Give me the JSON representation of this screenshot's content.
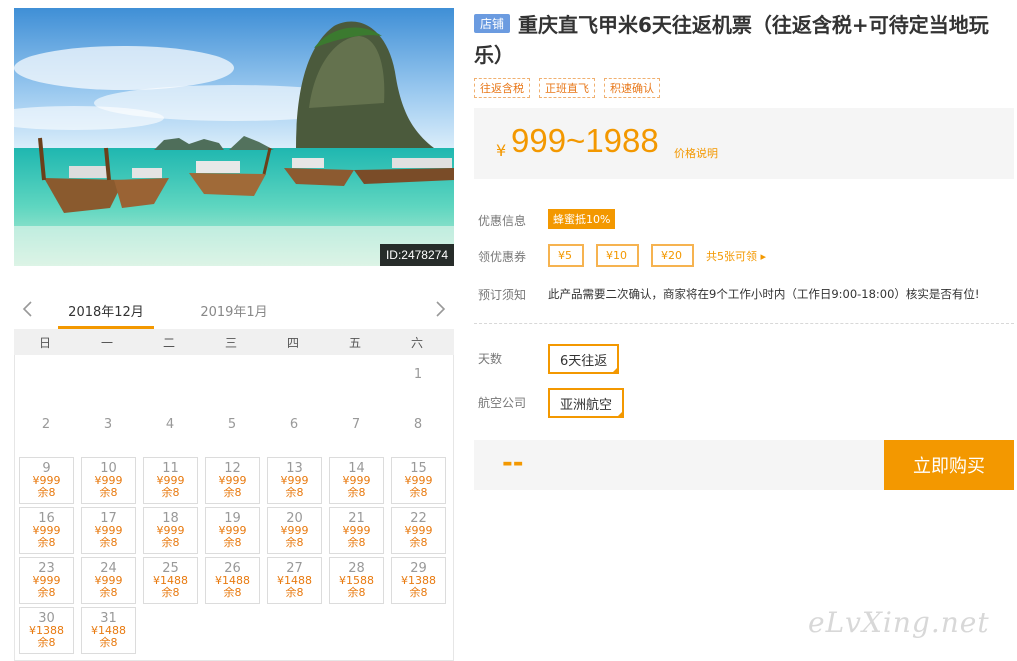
{
  "photo": {
    "id_label": "ID:2478274"
  },
  "calendar": {
    "tab_active": "2018年12月",
    "tab_next": "2019年1月",
    "weekdays": [
      "日",
      "一",
      "二",
      "三",
      "四",
      "五",
      "六"
    ],
    "lead_blanks": 6,
    "plain_days": [
      "1",
      "2",
      "3",
      "4",
      "5",
      "6",
      "7",
      "8"
    ],
    "avail_days": [
      {
        "day": "9",
        "price": "¥999",
        "stock": "余8"
      },
      {
        "day": "10",
        "price": "¥999",
        "stock": "余8"
      },
      {
        "day": "11",
        "price": "¥999",
        "stock": "余8"
      },
      {
        "day": "12",
        "price": "¥999",
        "stock": "余8"
      },
      {
        "day": "13",
        "price": "¥999",
        "stock": "余8"
      },
      {
        "day": "14",
        "price": "¥999",
        "stock": "余8"
      },
      {
        "day": "15",
        "price": "¥999",
        "stock": "余8"
      },
      {
        "day": "16",
        "price": "¥999",
        "stock": "余8"
      },
      {
        "day": "17",
        "price": "¥999",
        "stock": "余8"
      },
      {
        "day": "18",
        "price": "¥999",
        "stock": "余8"
      },
      {
        "day": "19",
        "price": "¥999",
        "stock": "余8"
      },
      {
        "day": "20",
        "price": "¥999",
        "stock": "余8"
      },
      {
        "day": "21",
        "price": "¥999",
        "stock": "余8"
      },
      {
        "day": "22",
        "price": "¥999",
        "stock": "余8"
      },
      {
        "day": "23",
        "price": "¥999",
        "stock": "余8"
      },
      {
        "day": "24",
        "price": "¥999",
        "stock": "余8"
      },
      {
        "day": "25",
        "price": "¥1488",
        "stock": "余8"
      },
      {
        "day": "26",
        "price": "¥1488",
        "stock": "余8"
      },
      {
        "day": "27",
        "price": "¥1488",
        "stock": "余8"
      },
      {
        "day": "28",
        "price": "¥1588",
        "stock": "余8"
      },
      {
        "day": "29",
        "price": "¥1388",
        "stock": "余8"
      },
      {
        "day": "30",
        "price": "¥1388",
        "stock": "余8"
      },
      {
        "day": "31",
        "price": "¥1488",
        "stock": "余8"
      }
    ]
  },
  "product": {
    "shop_badge": "店铺",
    "title": "重庆直飞甲米6天往返机票（往返含税+可待定当地玩乐）",
    "tags": [
      "往返含税",
      "正班直飞",
      "积速确认"
    ],
    "price_currency": "¥",
    "price_range": "999~1988",
    "price_note": "价格说明"
  },
  "info": {
    "discount_label": "优惠信息",
    "discount_badge": "蜂蜜抵10%",
    "coupon_label": "领优惠券",
    "coupons": [
      "¥5",
      "¥10",
      "¥20"
    ],
    "coupon_more": "共5张可领 ▸",
    "notice_label": "预订须知",
    "notice_text": "此产品需要二次确认，商家将在9个工作小时内（工作日9:00-18:00）核实是否有位!"
  },
  "options": {
    "days_label": "天数",
    "days_value": "6天往返",
    "airline_label": "航空公司",
    "airline_value": "亚洲航空"
  },
  "buy": {
    "total_placeholder": "--",
    "buy_label": "立即购买"
  },
  "watermark": "eLvXing.net",
  "colors": {
    "accent": "#f39800",
    "badge_blue": "#6b9be0"
  }
}
